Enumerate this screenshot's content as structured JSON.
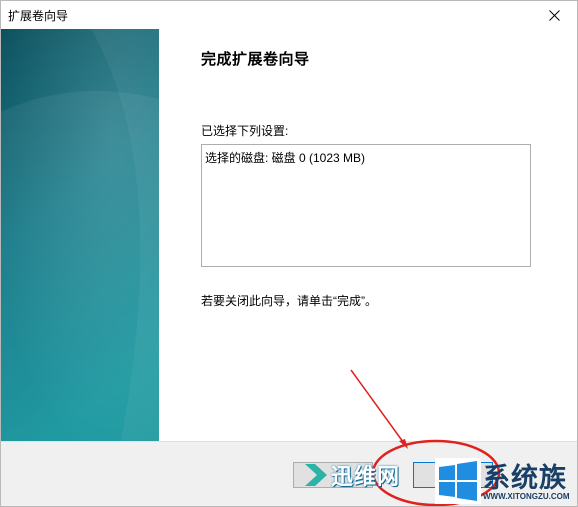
{
  "window": {
    "title": "扩展卷向导"
  },
  "wizard": {
    "heading": "完成扩展卷向导",
    "settings_label": "已选择下列设置:",
    "summary": "选择的磁盘: 磁盘 0 (1023 MB)",
    "note": "若要关闭此向导，请单击“完成”。"
  },
  "watermark": {
    "left_text": "迅维网",
    "right_text": "系统族",
    "url": "WWW.XITONGZU.COM"
  },
  "colors": {
    "side_panel_dark": "#0b4f5c",
    "side_panel_light": "#128a96",
    "annotation_red": "#e0221e",
    "footer": "#f0f0f0"
  }
}
